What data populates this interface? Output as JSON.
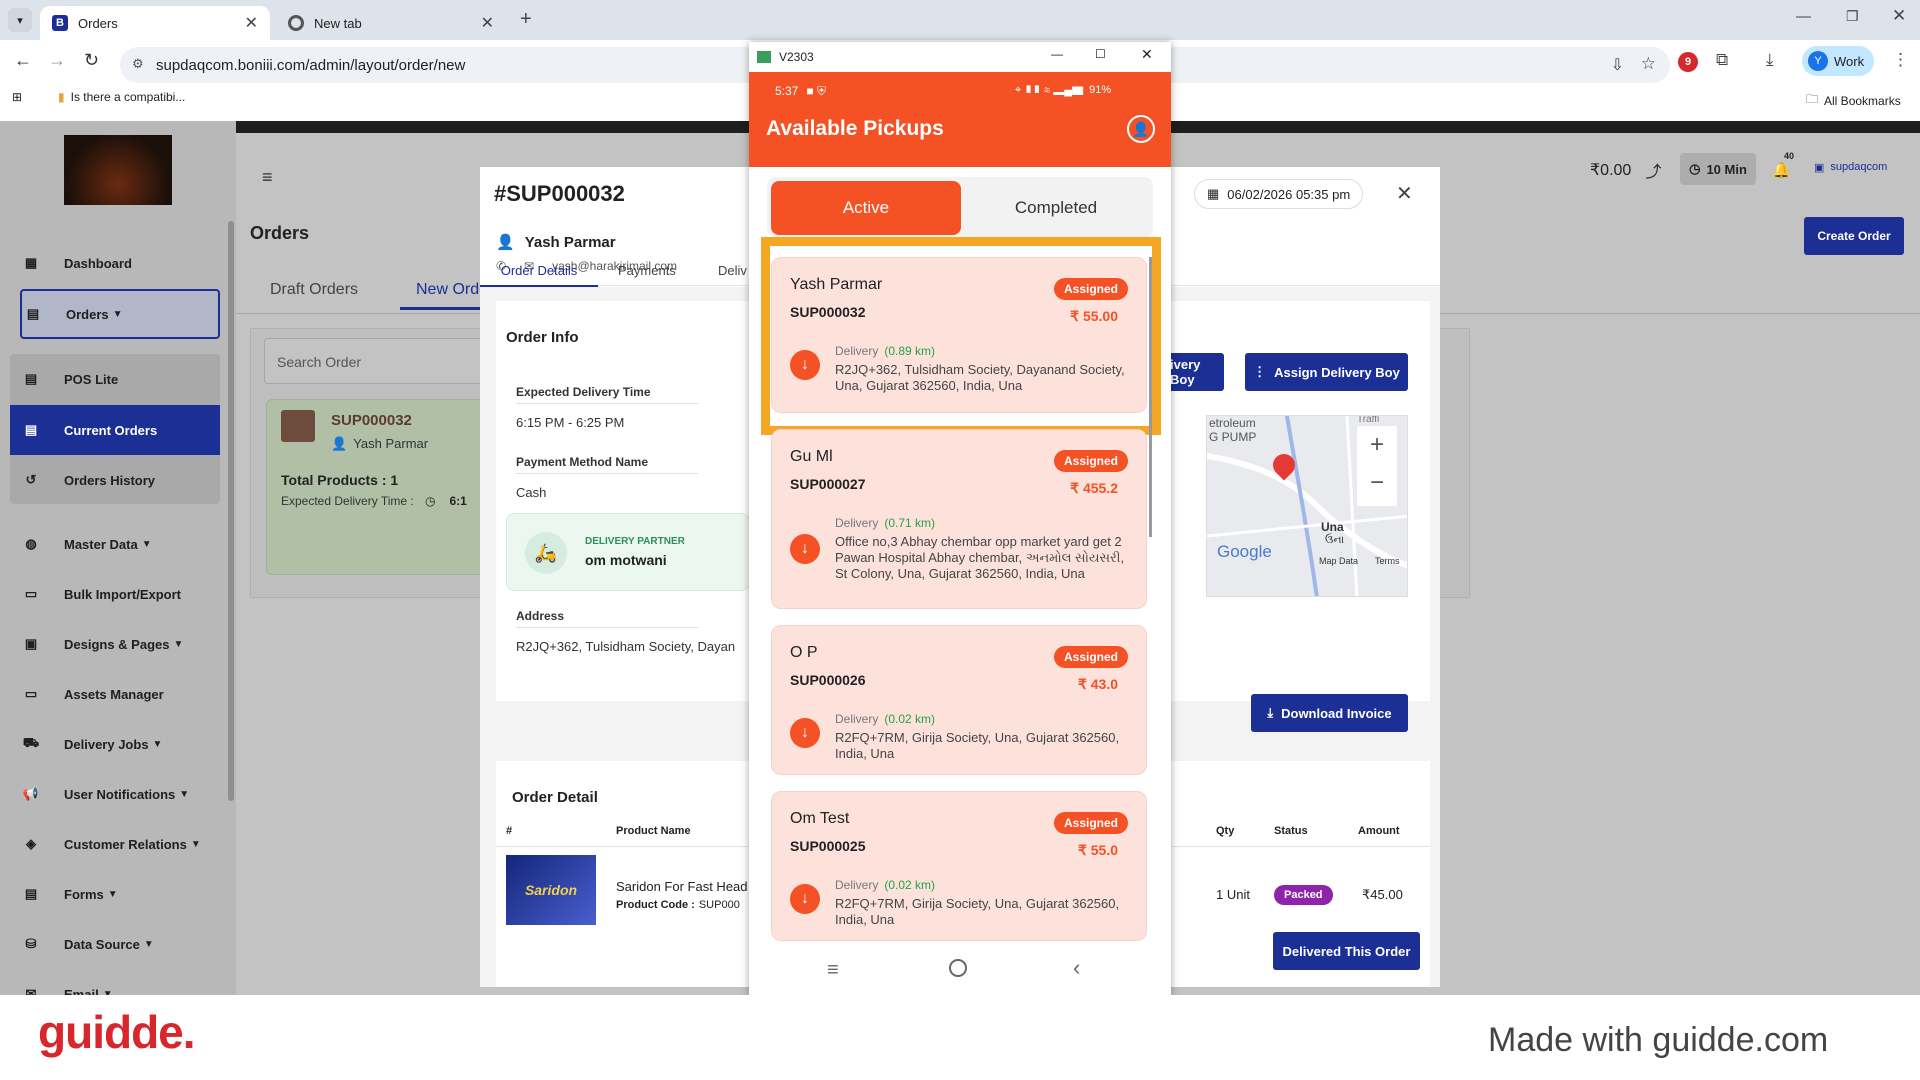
{
  "browser": {
    "tabs": [
      {
        "label": "Orders"
      },
      {
        "label": "New tab"
      }
    ],
    "url": "supdaqcom.boniii.com/admin/layout/order/new",
    "bookmark": "Is there a compatibi...",
    "all_bookmarks": "All Bookmarks",
    "profile_label": "Work",
    "profile_initial": "Y"
  },
  "app": {
    "sidebar": {
      "items": [
        {
          "label": "Dashboard"
        },
        {
          "label": "Orders"
        },
        {
          "label": "POS Lite"
        },
        {
          "label": "Current Orders"
        },
        {
          "label": "Orders History"
        },
        {
          "label": "Master Data"
        },
        {
          "label": "Bulk Import/Export"
        },
        {
          "label": "Designs & Pages"
        },
        {
          "label": "Assets Manager"
        },
        {
          "label": "Delivery Jobs"
        },
        {
          "label": "User Notifications"
        },
        {
          "label": "Customer Relations"
        },
        {
          "label": "Forms"
        },
        {
          "label": "Data Source"
        },
        {
          "label": "Email"
        }
      ]
    },
    "header": {
      "balance": "₹0.00",
      "timer": "10 Min",
      "notif_count": "40",
      "store": "supdaqcom"
    },
    "page_title": "Orders",
    "create_order": "Create Order",
    "tabs": [
      {
        "label": "Draft Orders"
      },
      {
        "label": "New Orders"
      }
    ],
    "search_placeholder": "Search Order",
    "order_card": {
      "id": "SUP000032",
      "customer": "Yash Parmar",
      "total_label": "Total Products : 1",
      "expected_label": "Expected Delivery Time :",
      "expected_value": "6:1"
    }
  },
  "modal": {
    "order_id": "#SUP000032",
    "customer": "Yash Parmar",
    "email": "yash@harakirimail.com",
    "datetime": "06/02/2026 05:35 pm",
    "tabs": [
      {
        "label": "Order Details"
      },
      {
        "label": "Payments"
      },
      {
        "label": "Deliv"
      }
    ],
    "order_info_title": "Order Info",
    "expected_delivery_label": "Expected Delivery Time",
    "expected_delivery_value": "6:15 PM - 6:25 PM",
    "payment_method_label": "Payment Method Name",
    "payment_method_value": "Cash",
    "partner_label": "DELIVERY PARTNER",
    "partner_name": "om motwani",
    "address_label": "Address",
    "address_value": "R2JQ+362, Tulsidham Society, Dayan",
    "btn_delivery_boy": "ivery Boy",
    "btn_assign": "Assign Delivery Boy",
    "btn_invoice": "Download Invoice",
    "btn_delivered": "Delivered This Order",
    "map": {
      "label_petrol": "etroleum\nG PUMP",
      "label_city": "Una",
      "label_city_local": "ઉના",
      "google": "Google",
      "map_data": "Map Data",
      "terms": "Terms",
      "label_traffic": "Traffi"
    },
    "order_detail_title": "Order Detail",
    "table": {
      "headers": [
        "#",
        "Product Name",
        "Qty",
        "Status",
        "Amount"
      ],
      "row": {
        "product": "Saridon For Fast Head",
        "code_label": "Product Code :",
        "code_value": "SUP000",
        "qty": "1 Unit",
        "status": "Packed",
        "amount": "₹45.00"
      }
    },
    "product_image_text": "Saridon"
  },
  "phone": {
    "window_title": "V2303",
    "status_time": "5:37",
    "status_battery": "91%",
    "title": "Available Pickups",
    "tabs": [
      {
        "label": "Active"
      },
      {
        "label": "Completed"
      }
    ],
    "pickups": [
      {
        "name": "Yash Parmar",
        "id": "SUP000032",
        "badge": "Assigned",
        "amount": "₹ 55.00",
        "delivery_label": "Delivery",
        "distance": "(0.89 km)",
        "address": "R2JQ+362, Tulsidham Society, Dayanand Society, Una, Gujarat 362560, India, Una"
      },
      {
        "name": "Gu Ml",
        "id": "SUP000027",
        "badge": "Assigned",
        "amount": "₹ 455.2",
        "delivery_label": "Delivery",
        "distance": "(0.71 km)",
        "address": "Office no,3 Abhay chembar opp market yard get 2 Pawan Hospital Abhay chembar, અનમોલ સોયસરી, St Colony, Una, Gujarat 362560, India, Una"
      },
      {
        "name": "O P",
        "id": "SUP000026",
        "badge": "Assigned",
        "amount": "₹ 43.0",
        "delivery_label": "Delivery",
        "distance": "(0.02 km)",
        "address": "R2FQ+7RM, Girija Society, Una, Gujarat 362560, India, Una"
      },
      {
        "name": "Om Test",
        "id": "SUP000025",
        "badge": "Assigned",
        "amount": "₹ 55.0",
        "delivery_label": "Delivery",
        "distance": "(0.02 km)",
        "address": "R2FQ+7RM, Girija Society, Una, Gujarat 362560, India, Una"
      }
    ]
  },
  "footer": {
    "brand": "guidde.",
    "made_with": "Made with guidde.com"
  },
  "colors": {
    "accent_orange": "#f45125",
    "brand_blue": "#1b2f94",
    "highlight_yellow": "#f5a623",
    "guidde_red": "#d7262c"
  }
}
